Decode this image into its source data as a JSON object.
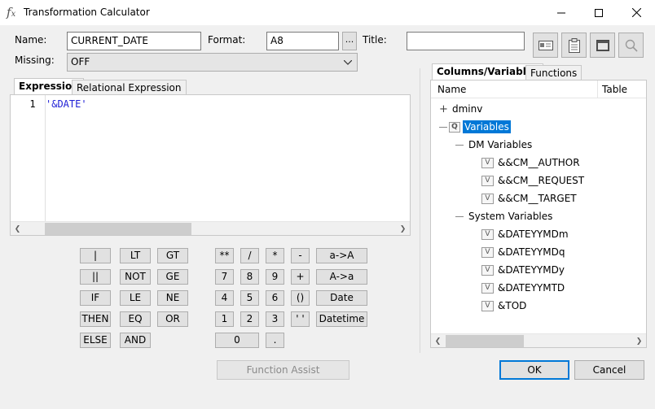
{
  "window": {
    "title": "Transformation Calculator",
    "icon": "fx-icon"
  },
  "form": {
    "name_label": "Name:",
    "name_value": "CURRENT_DATE",
    "format_label": "Format:",
    "format_value": "A8",
    "format_browse_label": "...",
    "title_label": "Title:",
    "title_value": "",
    "missing_label": "Missing:",
    "missing_value": "OFF"
  },
  "editor": {
    "tabs": [
      "Expression",
      "Relational Expression"
    ],
    "active_tab": "Expression",
    "line_number": "1",
    "code": "'&DATE'"
  },
  "calculator": {
    "logic_col1": [
      "|",
      "||",
      "IF",
      "THEN",
      "ELSE"
    ],
    "logic_col2": [
      "LT",
      "NOT",
      "LE",
      "EQ",
      "AND"
    ],
    "logic_col3": [
      "GT",
      "GE",
      "NE",
      "OR"
    ],
    "num_row1": [
      "**",
      "/",
      "*",
      "-"
    ],
    "num_row2": [
      "7",
      "8",
      "9",
      "+"
    ],
    "num_row3": [
      "4",
      "5",
      "6",
      "()"
    ],
    "num_row4": [
      "1",
      "2",
      "3",
      "' '"
    ],
    "zero": "0",
    "dot": ".",
    "right_col": [
      "a->A",
      "A->a",
      "Date",
      "Datetime"
    ],
    "function_assist": "Function Assist"
  },
  "panel": {
    "tabs": [
      "Columns/Variables",
      "Functions"
    ],
    "active_tab": "Columns/Variables",
    "col_name": "Name",
    "col_table": "Table",
    "tree": {
      "dminv": "dminv",
      "variables": "Variables",
      "dm_variables": "DM Variables",
      "dm_items": [
        "&&CM__AUTHOR",
        "&&CM__REQUEST",
        "&&CM__TARGET"
      ],
      "system_variables": "System Variables",
      "system_items": [
        "&DATEYYMDm",
        "&DATEYYMDq",
        "&DATEYYMDy",
        "&DATEYYMTD",
        "&TOD"
      ]
    }
  },
  "dialog": {
    "ok": "OK",
    "cancel": "Cancel"
  },
  "colors": {
    "accent": "#0078d7",
    "code_text": "#1f1fd6",
    "selection": "#0078d7"
  }
}
